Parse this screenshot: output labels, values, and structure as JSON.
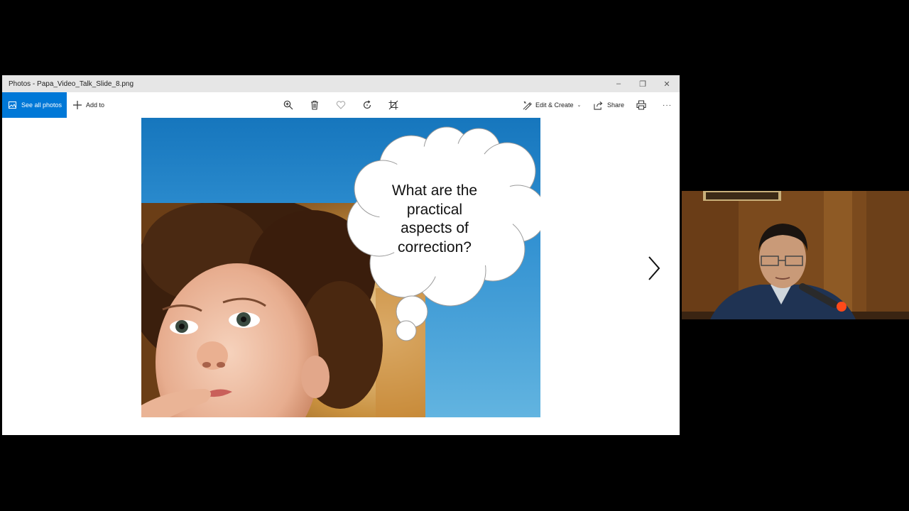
{
  "window": {
    "title": "Photos - Papa_Video_Talk_Slide_8.png",
    "controls": {
      "minimize": "–",
      "restore": "❐",
      "close": "✕"
    }
  },
  "toolbar": {
    "see_all_photos": "See all photos",
    "add_to": "Add to",
    "edit_create": "Edit & Create",
    "share": "Share",
    "more": "···",
    "icons": [
      "zoom-icon",
      "delete-icon",
      "favorite-icon",
      "rotate-icon",
      "crop-icon",
      "print-icon"
    ]
  },
  "slide": {
    "bubble_lines": [
      "What are the",
      "practical",
      "aspects of",
      "correction?"
    ]
  },
  "colors": {
    "accent": "#0078d7",
    "titlebar": "#e6e6e6"
  }
}
